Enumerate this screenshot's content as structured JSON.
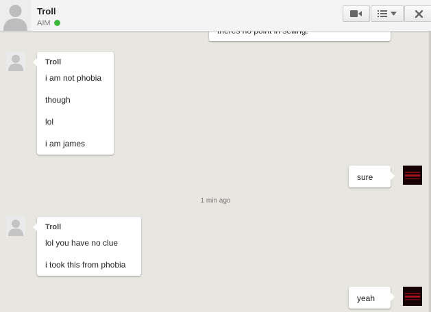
{
  "header": {
    "contact_name": "Troll",
    "status_label": "AIM",
    "status_color": "#3cb93c",
    "buttons": [
      "video-call",
      "menu",
      "close"
    ]
  },
  "conversation": {
    "clipped_top_message": "theres no point in selling.",
    "messages": [
      {
        "side": "left",
        "sender": "Troll",
        "lines": [
          "i am not phobia",
          "though",
          "lol",
          "i am james"
        ]
      },
      {
        "side": "right",
        "lines": [
          "sure"
        ]
      },
      {
        "type": "timestamp",
        "text": "1 min ago"
      },
      {
        "side": "left",
        "sender": "Troll",
        "lines": [
          "lol you have no clue",
          "i took this from phobia"
        ]
      },
      {
        "side": "right",
        "lines": [
          "yeah"
        ]
      }
    ]
  }
}
